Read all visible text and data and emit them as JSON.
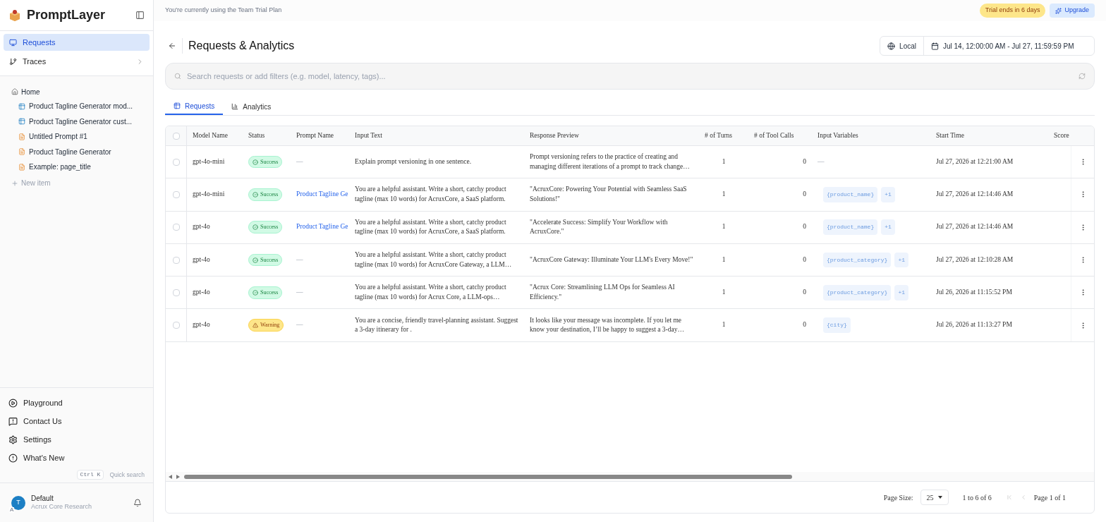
{
  "sidebar": {
    "brand": "PromptLayer",
    "nav": [
      {
        "label": "Requests",
        "selected": true,
        "kind": "requests"
      },
      {
        "label": "Traces",
        "selected": false,
        "kind": "traces"
      }
    ],
    "tree": {
      "label": "Home",
      "children": [
        {
          "label": "Product Tagline Generator mod...",
          "kind": "dataset"
        },
        {
          "label": "Product Tagline Generator cust...",
          "kind": "dataset"
        },
        {
          "label": "Untitled Prompt #1",
          "kind": "prompt"
        },
        {
          "label": "Product Tagline Generator",
          "kind": "prompt"
        },
        {
          "label": "Example: page_title",
          "kind": "prompt"
        }
      ]
    },
    "new_item": "New item",
    "bottom": [
      {
        "label": "Playground",
        "kind": "play"
      },
      {
        "label": "Contact Us",
        "kind": "contact"
      },
      {
        "label": "Settings",
        "kind": "settings"
      },
      {
        "label": "What's New",
        "kind": "news"
      }
    ],
    "shortcut": {
      "keys": "Ctrl K",
      "label": "Quick search"
    },
    "user": {
      "avatar": "T",
      "badge": "A",
      "name": "Default",
      "org": "Acrux Core Research"
    }
  },
  "banner": {
    "text": "You're currently using the Team Trial Plan",
    "trial": "Trial ends in 6 days",
    "upgrade": "Upgrade"
  },
  "header": {
    "title": "Requests & Analytics",
    "timezone": "Local",
    "date_range": "Jul 14, 12:00:00 AM - Jul 27, 11:59:59 PM"
  },
  "search": {
    "placeholder": "Search requests or add filters (e.g. model, latency, tags)..."
  },
  "tabs": [
    {
      "label": "Requests",
      "selected": true,
      "kind": "table"
    },
    {
      "label": "Analytics",
      "selected": false,
      "kind": "chart"
    }
  ],
  "table": {
    "select_all": {
      "checked": false
    },
    "columns": [
      "Model Name",
      "Status",
      "Prompt Name",
      "Input Text",
      "Response Preview",
      "# of Turns",
      "# of Tool Calls",
      "Input Variables",
      "Start Time",
      "Score"
    ],
    "rows": [
      {
        "checked": false,
        "model": "gpt-4o-mini",
        "status": {
          "label": "Success",
          "kind": "success"
        },
        "prompt_name": "—",
        "prompt_link": false,
        "input_text": "Explain prompt versioning in one sentence.",
        "response_preview": "Prompt versioning refers to the practice of creating and managing different iterations of a prompt to track change…",
        "turns": "1",
        "tool_calls": "0",
        "input_variables": [],
        "no_variables": "—",
        "start_time": "Jul 27, 2026 at 12:21:00 AM"
      },
      {
        "checked": false,
        "model": "gpt-4o-mini",
        "status": {
          "label": "Success",
          "kind": "success"
        },
        "prompt_name": "Product Tagline Ge",
        "prompt_link": true,
        "input_text": "You are a helpful assistant. Write a short, catchy product tagline (max 10 words) for AcruxCore, a SaaS platform.",
        "response_preview": "\"AcruxCore: Powering Your Potential with Seamless SaaS Solutions!\"",
        "turns": "1",
        "tool_calls": "0",
        "input_variables": [
          "{product_name}",
          "+1"
        ],
        "start_time": "Jul 27, 2026 at 12:14:46 AM"
      },
      {
        "checked": false,
        "model": "gpt-4o",
        "status": {
          "label": "Success",
          "kind": "success"
        },
        "prompt_name": "Product Tagline Ge",
        "prompt_link": true,
        "input_text": "You are a helpful assistant. Write a short, catchy product tagline (max 10 words) for AcruxCore, a SaaS platform.",
        "response_preview": "\"Accelerate Success: Simplify Your Workflow with AcruxCore.\"",
        "turns": "1",
        "tool_calls": "0",
        "input_variables": [
          "{product_name}",
          "+1"
        ],
        "start_time": "Jul 27, 2026 at 12:14:46 AM"
      },
      {
        "checked": false,
        "model": "gpt-4o",
        "status": {
          "label": "Success",
          "kind": "success"
        },
        "prompt_name": "—",
        "prompt_link": false,
        "input_text": "You are a helpful assistant. Write a short, catchy product tagline (max 10 words) for AcruxCore Gateway, a LLM…",
        "response_preview": "\"AcruxCore Gateway: Illuminate Your LLM's Every Move!\"",
        "turns": "1",
        "tool_calls": "0",
        "input_variables": [
          "{product_category}",
          "+1"
        ],
        "start_time": "Jul 27, 2026 at 12:10:28 AM"
      },
      {
        "checked": false,
        "model": "gpt-4o",
        "status": {
          "label": "Success",
          "kind": "success"
        },
        "prompt_name": "—",
        "prompt_link": false,
        "input_text": "You are a helpful assistant. Write a short, catchy product tagline (max 10 words) for Acrux Core, a LLM-ops…",
        "response_preview": "\"Acrux Core: Streamlining LLM Ops for Seamless AI Efficiency.\"",
        "turns": "1",
        "tool_calls": "0",
        "input_variables": [
          "{product_category}",
          "+1"
        ],
        "start_time": "Jul 26, 2026 at 11:15:52 PM"
      },
      {
        "checked": false,
        "model": "gpt-4o",
        "status": {
          "label": "Warning",
          "kind": "warning"
        },
        "prompt_name": "—",
        "prompt_link": false,
        "input_text": "You are a concise, friendly travel-planning assistant. Suggest a 3-day itinerary for .",
        "response_preview": "It looks like your message was incomplete. If you let me know your destination, I’ll be happy to suggest a 3-day…",
        "turns": "1",
        "tool_calls": "0",
        "input_variables": [
          "{city}"
        ],
        "start_time": "Jul 26, 2026 at 11:13:27 PM"
      }
    ]
  },
  "pagination": {
    "page_size_label": "Page Size:",
    "page_size": "25",
    "range": "1 to 6 of 6",
    "page": "Page 1 of 1"
  }
}
